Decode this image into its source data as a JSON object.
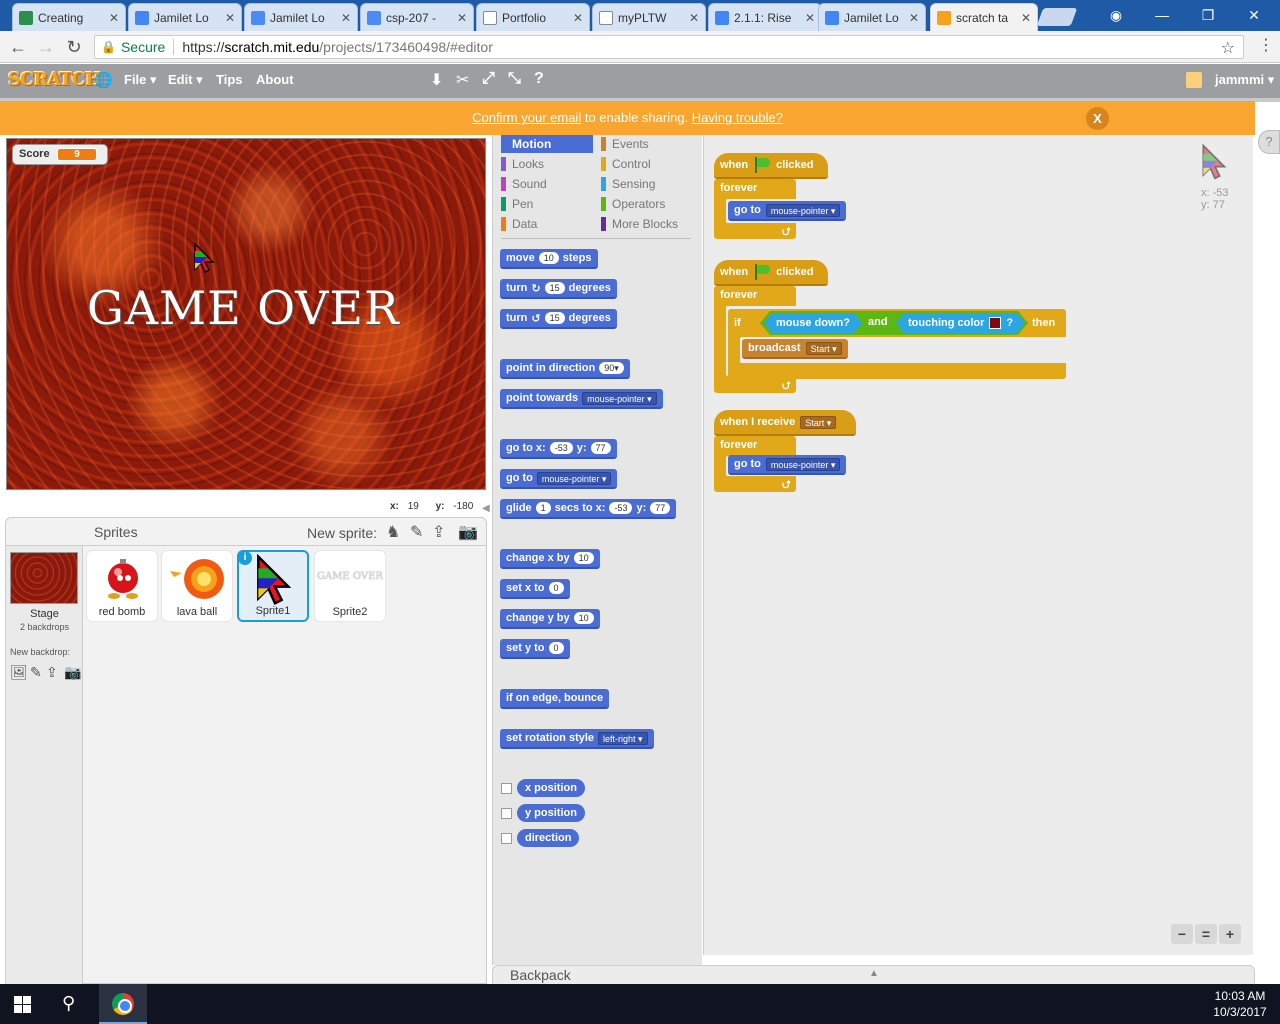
{
  "browser": {
    "tabs": [
      {
        "title": "Creating ",
        "favicon": "#2d8f4e"
      },
      {
        "title": "Jamilet Lo",
        "favicon": "#4285f4"
      },
      {
        "title": "Jamilet Lo",
        "favicon": "#4c8bf5"
      },
      {
        "title": "csp-207 -",
        "favicon": "#4c8bf5"
      },
      {
        "title": "Portfolio",
        "favicon": "#ffffff"
      },
      {
        "title": "myPLTW",
        "favicon": "#ffffff"
      },
      {
        "title": "2.1.1: Rise",
        "favicon": "#4285f4"
      },
      {
        "title": "Jamilet Lo",
        "favicon": "#4285f4"
      },
      {
        "title": "scratch ta",
        "favicon": "#f6a21b"
      }
    ],
    "secure_label": "Secure",
    "url_scheme": "https://",
    "url_host": "scratch.mit.edu",
    "url_path": "/projects/173460498/#editor"
  },
  "scratch_menu": {
    "logo": "SCRATCH",
    "file": "File ▾",
    "edit": "Edit ▾",
    "tips": "Tips",
    "about": "About",
    "user": "jammmi ▾"
  },
  "notice": {
    "confirm_link": "Confirm your email",
    "middle_text": " to enable sharing. ",
    "trouble_link": "Having trouble?",
    "close": "X"
  },
  "help_tab": "?",
  "stage": {
    "score_label": "Score",
    "score_value": "9",
    "game_over": "GAME OVER",
    "mouse_x_label": "x:",
    "mouse_x": "19",
    "mouse_y_label": "y:",
    "mouse_y": "-180"
  },
  "sprite_pane": {
    "title": "Sprites",
    "new_sprite": "New sprite:",
    "stage_label": "Stage",
    "stage_backdrops": "2 backdrops",
    "new_backdrop": "New backdrop:",
    "sprites": [
      {
        "name": "red bomb"
      },
      {
        "name": "lava ball"
      },
      {
        "name": "Sprite1",
        "selected": true
      },
      {
        "name": "Sprite2",
        "thumb_text": "GAME OVER"
      }
    ]
  },
  "palette": {
    "categories": [
      {
        "label": "Motion",
        "color": "#4a6cd4"
      },
      {
        "label": "Events",
        "color": "#c88330"
      },
      {
        "label": "Looks",
        "color": "#8a55d7"
      },
      {
        "label": "Control",
        "color": "#e1a91a"
      },
      {
        "label": "Sound",
        "color": "#bb42c3"
      },
      {
        "label": "Sensing",
        "color": "#2ca5e2"
      },
      {
        "label": "Pen",
        "color": "#0e9a6c"
      },
      {
        "label": "Operators",
        "color": "#5cb712"
      },
      {
        "label": "Data",
        "color": "#ee7d16"
      },
      {
        "label": "More Blocks",
        "color": "#632d99"
      }
    ],
    "blocks": {
      "move": "move",
      "move_steps": "10",
      "steps": "steps",
      "turn": "turn",
      "turn_cw": "↻",
      "turn_ccw": "↺",
      "turn_deg": "15",
      "degrees": "degrees",
      "point_dir": "point in direction",
      "dir_val": "90▾",
      "point_towards": "point towards",
      "mouse_pointer": "mouse-pointer ▾",
      "goto_xy": "go to x:",
      "x_val": "-53",
      "y_label": "y:",
      "y_val": "77",
      "goto": "go to",
      "glide": "glide",
      "glide_secs": "1",
      "secs_to_x": "secs to x:",
      "change_x": "change x by",
      "change_val": "10",
      "set_x": "set x to",
      "zero": "0",
      "change_y": "change y by",
      "set_y": "set y to",
      "bounce": "if on edge, bounce",
      "rot_style": "set rotation style",
      "rot_val": "left-right ▾",
      "x_position": "x position",
      "y_position": "y position",
      "direction": "direction"
    }
  },
  "scripts": {
    "when": "when",
    "clicked": "clicked",
    "forever": "forever",
    "go_to": "go to",
    "mouse_pointer": "mouse-pointer ▾",
    "if": "if",
    "mouse_down": "mouse down?",
    "and": "and",
    "touching_color": "touching color",
    "question": "?",
    "then": "then",
    "broadcast": "broadcast",
    "start": "Start ▾",
    "when_receive": "when I receive",
    "sprite_x": "x: -53",
    "sprite_y": "y: 77"
  },
  "backpack": "Backpack",
  "taskbar": {
    "time": "10:03 AM",
    "date": "10/3/2017"
  }
}
